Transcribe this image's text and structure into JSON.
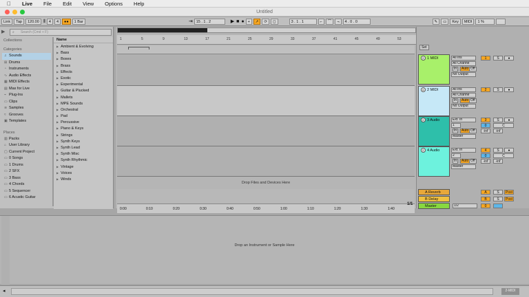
{
  "menu": {
    "apple": "",
    "items": [
      "Live",
      "File",
      "Edit",
      "View",
      "Options",
      "Help"
    ]
  },
  "window": {
    "title": "Untitled"
  },
  "control": {
    "link": "Link",
    "tap": "Tap",
    "tempo": "120.00",
    "meter_num": "4",
    "meter_den": "4",
    "metronome": "●●",
    "quantize": "1 Bar",
    "position": "15 .  1 .  2",
    "loop_start": "3 .  1 .  1",
    "loop_length": "4 .  0 .  0",
    "key": "Key",
    "midi": "MIDI",
    "cpu": "1 %",
    "icons": [
      "play-icon",
      "stop-icon",
      "record-icon"
    ]
  },
  "browser": {
    "search_placeholder": "Search (Cmd + F)",
    "collections_label": "Collections",
    "categories_label": "Categories",
    "categories": [
      "Sounds",
      "Drums",
      "Instruments",
      "Audio Effects",
      "MIDI Effects",
      "Max for Live",
      "Plug-Ins",
      "Clips",
      "Samples",
      "Grooves",
      "Templates"
    ],
    "places_label": "Places",
    "places": [
      "Packs",
      "User Library",
      "Current Project",
      "0 Songs",
      "1 Drums",
      "2 SFX",
      "3 Bass",
      "4 Chords",
      "5 Sequencer",
      "6 Acustic Guitar"
    ],
    "name_header": "Name",
    "items": [
      "Ambient & Evolving",
      "Bass",
      "Boxes",
      "Brass",
      "Effects",
      "Exotic",
      "Experimental",
      "Guitar & Plucked",
      "Mallets",
      "MPE Sounds",
      "Orchestral",
      "Pad",
      "Percussive",
      "Piano & Keys",
      "Strings",
      "Synth Keys",
      "Synth Lead",
      "Synth Misc",
      "Synth Rhythmic",
      "Vintage",
      "Voices",
      "Winds"
    ]
  },
  "arrangement": {
    "bars": [
      "1",
      "5",
      "9",
      "13",
      "17",
      "21",
      "25",
      "29",
      "33",
      "37",
      "41",
      "45",
      "49",
      "53"
    ],
    "times": [
      "0:00",
      "0:10",
      "0:20",
      "0:30",
      "0:40",
      "0:50",
      "1:00",
      "1:10",
      "1:20",
      "1:30",
      "1:40"
    ],
    "drop_files": "Drop Files and Devices Here",
    "loop_fraction": "1/1",
    "set_label": "Set"
  },
  "tracks": [
    {
      "name": "1 MIDI",
      "color": "#a8f06a",
      "input": "All Ins",
      "channel": "All Channe",
      "monitor": [
        "In",
        "Auto",
        "Off"
      ],
      "output": "No Output",
      "number": "1"
    },
    {
      "name": "2 MIDI",
      "color": "#c6e8f7",
      "input": "All Ins",
      "channel": "All Channe",
      "monitor": [
        "In",
        "Auto",
        "Off"
      ],
      "output": "No Output",
      "number": "2"
    },
    {
      "name": "3 Audio",
      "color": "#2ebfaa",
      "input": "Ext. In",
      "channel": "1",
      "monitor": [
        "In",
        "Auto",
        "Off"
      ],
      "output": "Master",
      "number": "3",
      "vol": "-inf",
      "pan": "-inf",
      "c": "C",
      "zero": "0"
    },
    {
      "name": "4 Audio",
      "color": "#6df2dd",
      "input": "Ext. In",
      "channel": "2",
      "monitor": [
        "In",
        "Auto",
        "Off"
      ],
      "output": "Master",
      "number": "4",
      "vol": "-inf",
      "pan": "-inf",
      "c": "C",
      "zero": "0"
    }
  ],
  "returns": [
    {
      "name": "A Reverb",
      "letter": "A",
      "label": "Post",
      "s": "S",
      "color": "#e8a83a"
    },
    {
      "name": "B Delay",
      "letter": "B",
      "label": "Post",
      "s": "S",
      "color": "#f0c040"
    },
    {
      "name": "Master",
      "output": "1/2",
      "zero": "0",
      "color": "#88d840"
    }
  ],
  "detail": {
    "drop_instrument": "Drop an Instrument or Sample Here",
    "status_tag": "2-MIDI"
  }
}
